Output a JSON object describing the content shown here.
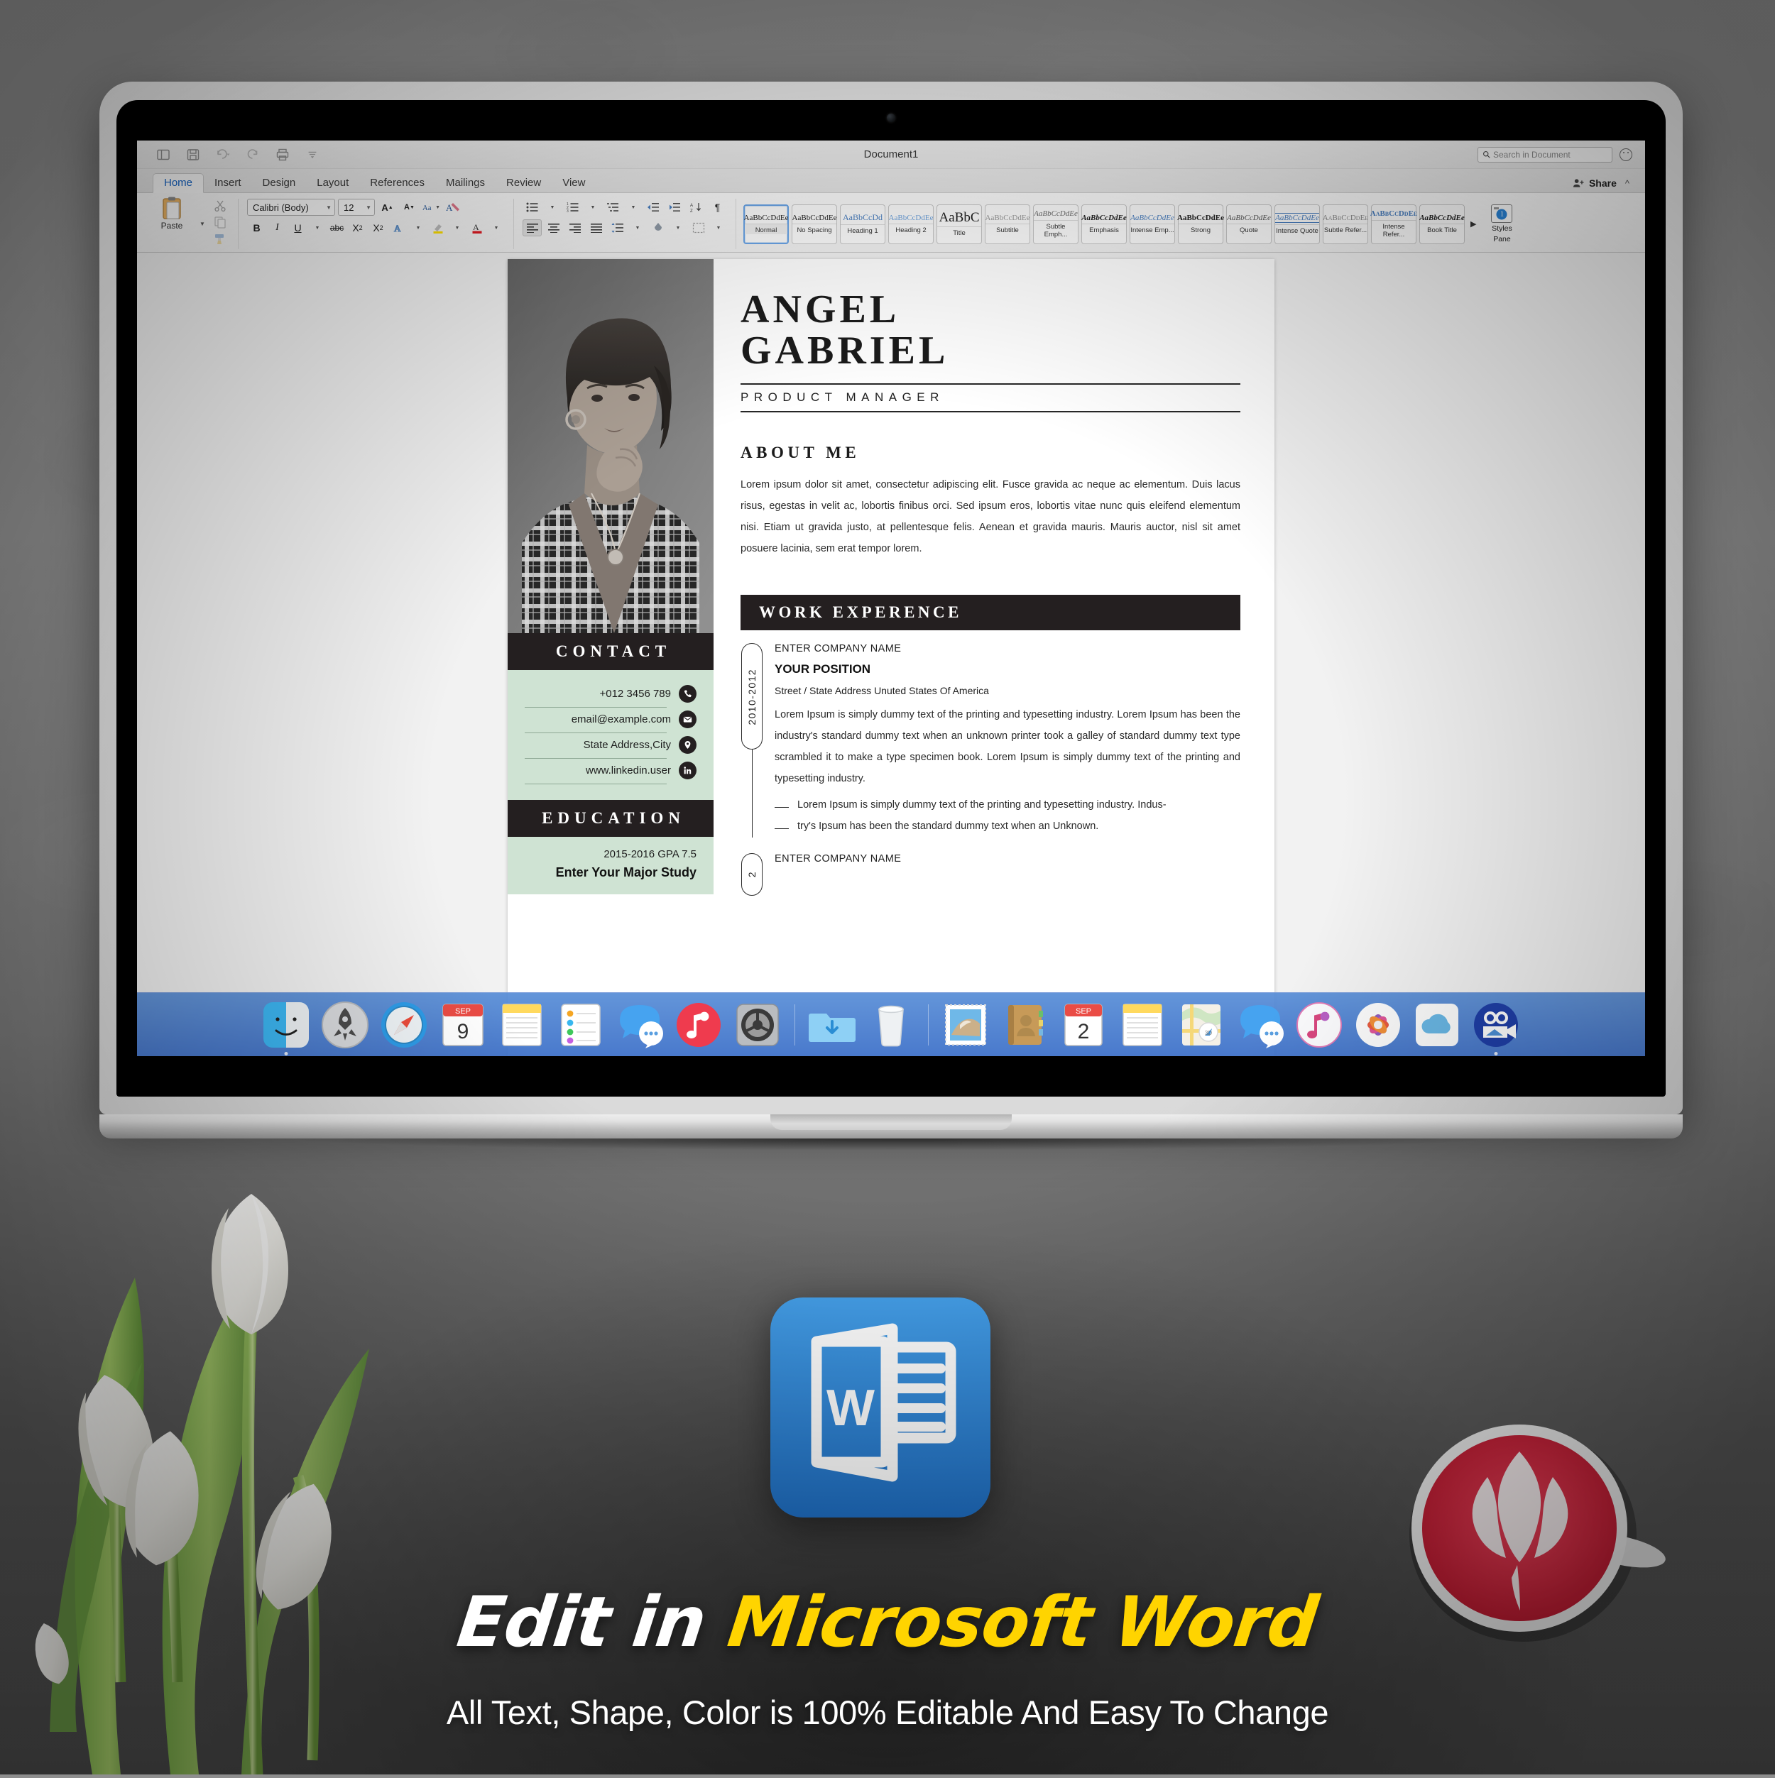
{
  "window": {
    "doc_title": "Document1",
    "search_placeholder": "Search in Document",
    "share_label": "Share",
    "quick_access": [
      "sidebar-icon",
      "save-icon",
      "undo-icon",
      "redo-icon",
      "print-icon",
      "customize-icon"
    ]
  },
  "tabs": [
    {
      "label": "Home",
      "active": true
    },
    {
      "label": "Insert",
      "active": false
    },
    {
      "label": "Design",
      "active": false
    },
    {
      "label": "Layout",
      "active": false
    },
    {
      "label": "References",
      "active": false
    },
    {
      "label": "Mailings",
      "active": false
    },
    {
      "label": "Review",
      "active": false
    },
    {
      "label": "View",
      "active": false
    }
  ],
  "ribbon": {
    "paste_label": "Paste",
    "font_name": "Calibri (Body)",
    "font_size": "12",
    "styles_pane_label": "Styles\nPane",
    "styles_pane_line1": "Styles",
    "styles_pane_line2": "Pane",
    "more_arrow": "▶",
    "styles": [
      {
        "sample": "AaBbCcDdEe",
        "name": "Normal",
        "selected": true
      },
      {
        "sample": "AaBbCcDdEe",
        "name": "No Spacing",
        "selected": false
      },
      {
        "sample": "AaBbCcDd",
        "name": "Heading 1",
        "selected": false
      },
      {
        "sample": "AaBbCcDdEe",
        "name": "Heading 2",
        "selected": false
      },
      {
        "sample": "AaBbC",
        "name": "Title",
        "selected": false
      },
      {
        "sample": "AaBbCcDdEe",
        "name": "Subtitle",
        "selected": false
      },
      {
        "sample": "AaBbCcDdEe",
        "name": "Subtle Emph...",
        "selected": false
      },
      {
        "sample": "AaBbCcDdEe",
        "name": "Emphasis",
        "selected": false
      },
      {
        "sample": "AaBbCcDdEe",
        "name": "Intense Emp...",
        "selected": false
      },
      {
        "sample": "AaBbCcDdEe",
        "name": "Strong",
        "selected": false
      },
      {
        "sample": "AaBbCcDdEe",
        "name": "Quote",
        "selected": false
      },
      {
        "sample": "AaBbCcDdEe",
        "name": "Intense Quote",
        "selected": false
      },
      {
        "sample": "AaBbCcDdEe",
        "name": "Subtle Refer...",
        "selected": false
      },
      {
        "sample": "AaBbCcDdEe",
        "name": "Intense Refer...",
        "selected": false
      },
      {
        "sample": "AaBbCcDdEe",
        "name": "Book Title",
        "selected": false
      }
    ]
  },
  "resume": {
    "first_name": "ANGEL",
    "last_name": "GABRIEL",
    "role": "PRODUCT MANAGER",
    "about_heading": "ABOUT ME",
    "about_text": "Lorem ipsum dolor sit amet, consectetur adipiscing elit. Fusce gravida ac neque ac elementum. Duis lacus risus, egestas in velit ac, lobortis finibus orci. Sed ipsum eros, lobortis vitae nunc quis eleifend elementum nisi. Etiam ut gravida justo, at pellentesque felis. Aenean et gravida mauris. Mauris auctor, nisl sit amet posuere lacinia, sem erat tempor lorem.",
    "contact_heading": "CONTACT",
    "contact_items": [
      {
        "text": "+012 3456 789",
        "icon": "phone-icon"
      },
      {
        "text": "email@example.com",
        "icon": "envelope-icon"
      },
      {
        "text": "State Address,City",
        "icon": "location-pin-icon"
      },
      {
        "text": "www.linkedin.user",
        "icon": "linkedin-icon"
      }
    ],
    "education_heading": "EDUCATION",
    "education_year": "2015-2016 GPA 7.5",
    "education_major": "Enter Your Major Study",
    "work_heading": "WORK EXPERENCE",
    "jobs": [
      {
        "years": "2010-2012",
        "company": "ENTER COMPANY NAME",
        "position": "YOUR POSITION",
        "address": "Street / State Address Unuted States Of America",
        "paragraph": "Lorem Ipsum is simply dummy text of the printing and typesetting industry. Lorem Ipsum has been the industry's standard dummy text when an unknown printer took a galley of standard dummy text type scrambled it to make a type specimen book. Lorem Ipsum is simply dummy text of the printing and typesetting industry.",
        "bullets": [
          "Lorem Ipsum is simply dummy text of the printing and typesetting industry. Indus-",
          "try's Ipsum has been the  standard dummy text when an Unknown."
        ]
      },
      {
        "years": "2",
        "company": "ENTER COMPANY NAME",
        "position": "",
        "address": "",
        "paragraph": "",
        "bullets": []
      }
    ]
  },
  "dock": {
    "items": [
      {
        "name": "finder-icon",
        "running": true
      },
      {
        "name": "launchpad-icon",
        "running": false
      },
      {
        "name": "safari-icon",
        "running": false
      },
      {
        "name": "calendar-icon",
        "running": false,
        "month": "SEP",
        "day": "9"
      },
      {
        "name": "notes-icon",
        "running": false
      },
      {
        "name": "reminders-icon",
        "running": false
      },
      {
        "name": "messages-icon",
        "running": false
      },
      {
        "name": "itunes-icon",
        "running": false
      },
      {
        "name": "system-preferences-icon",
        "running": false
      },
      {
        "name": "downloads-folder-icon",
        "running": false
      },
      {
        "name": "trash-icon",
        "running": false
      },
      {
        "name": "mail-icon",
        "running": false
      },
      {
        "name": "contacts-icon",
        "running": false
      },
      {
        "name": "calendar-icon-2",
        "running": false,
        "month": "SEP",
        "day": "2"
      },
      {
        "name": "notes-icon-2",
        "running": false
      },
      {
        "name": "maps-icon",
        "running": false
      },
      {
        "name": "messages-icon-2",
        "running": false
      },
      {
        "name": "itunes-icon-2",
        "running": false
      },
      {
        "name": "photos-icon",
        "running": false
      },
      {
        "name": "icloud-icon",
        "running": false
      },
      {
        "name": "imovie-icon",
        "running": true
      }
    ]
  },
  "caption": {
    "headline_white": "Edit in",
    "headline_yellow": "Microsoft Word",
    "subline": "All Text, Shape, Color is 100% Editable And Easy To Change"
  },
  "colors": {
    "dark": "#241f20",
    "mint": "#cfe3d3",
    "accent_yellow": "#ffd400",
    "word_blue": "#2b7cd3",
    "dock_blue": "#4f86d6"
  }
}
